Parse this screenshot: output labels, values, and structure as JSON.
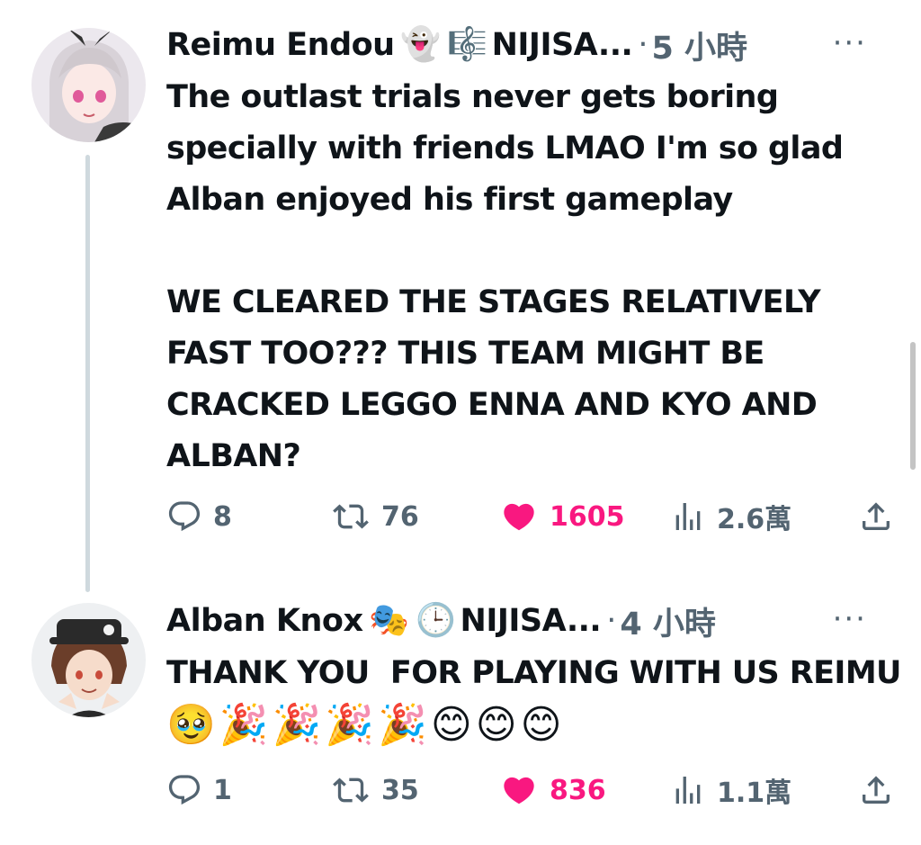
{
  "tweets": [
    {
      "name": "Reimu Endou",
      "badge_emojis": [
        "👻",
        "🎼"
      ],
      "handle": "NIJISA...",
      "separator": "·",
      "time": "5 小時",
      "more": "···",
      "text": "The outlast trials never gets boring specially with friends LMAO I'm so glad Alban enjoyed his first gameplay\n\nWE CLEARED THE STAGES RELATIVELY FAST TOO??? THIS TEAM MIGHT BE CRACKED LEGGO ENNA AND KYO AND ALBAN?",
      "replies": "8",
      "retweets": "76",
      "likes": "1605",
      "views": "2.6萬"
    },
    {
      "name": "Alban Knox",
      "badge_emojis": [
        "🎭",
        "🕒"
      ],
      "handle": "NIJISA...",
      "separator": "·",
      "time": "4 小時",
      "more": "···",
      "text": "THANK YOU  FOR PLAYING WITH US REIMU ",
      "text_emojis": "🥹🎉🎉🎉🎉😊😊😊",
      "replies": "1",
      "retweets": "35",
      "likes": "836",
      "views": "1.1萬"
    }
  ],
  "colors": {
    "like": "#f91880",
    "muted": "#536471",
    "text": "#0f1419",
    "thread_line": "#cfd9de"
  },
  "icons": [
    "reply-icon",
    "retweet-icon",
    "heart-icon",
    "views-icon",
    "share-icon",
    "more-icon"
  ]
}
